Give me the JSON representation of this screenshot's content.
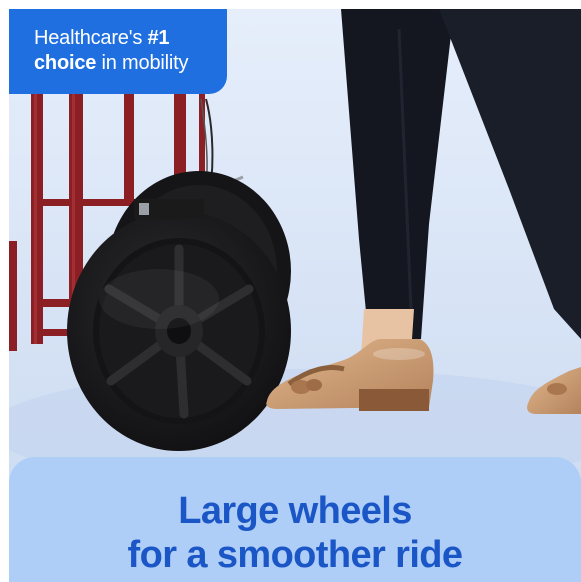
{
  "badge": {
    "line1": "Healthcare's",
    "line1_emphasis": "#1",
    "line2_emphasis": "choice",
    "line2": "in mobility"
  },
  "caption": {
    "line1": "Large wheels",
    "line2": "for a smoother ride"
  },
  "colors": {
    "badge_bg": "#1f6fe0",
    "caption_bg": "#aecdf7",
    "caption_text": "#1b56c6",
    "scene_bg": "#d9e6f7",
    "frame_red": "#8c1f24",
    "wheel_black": "#1c1c1e",
    "shoe_tan": "#c99a72",
    "pants_navy": "#14171f"
  }
}
